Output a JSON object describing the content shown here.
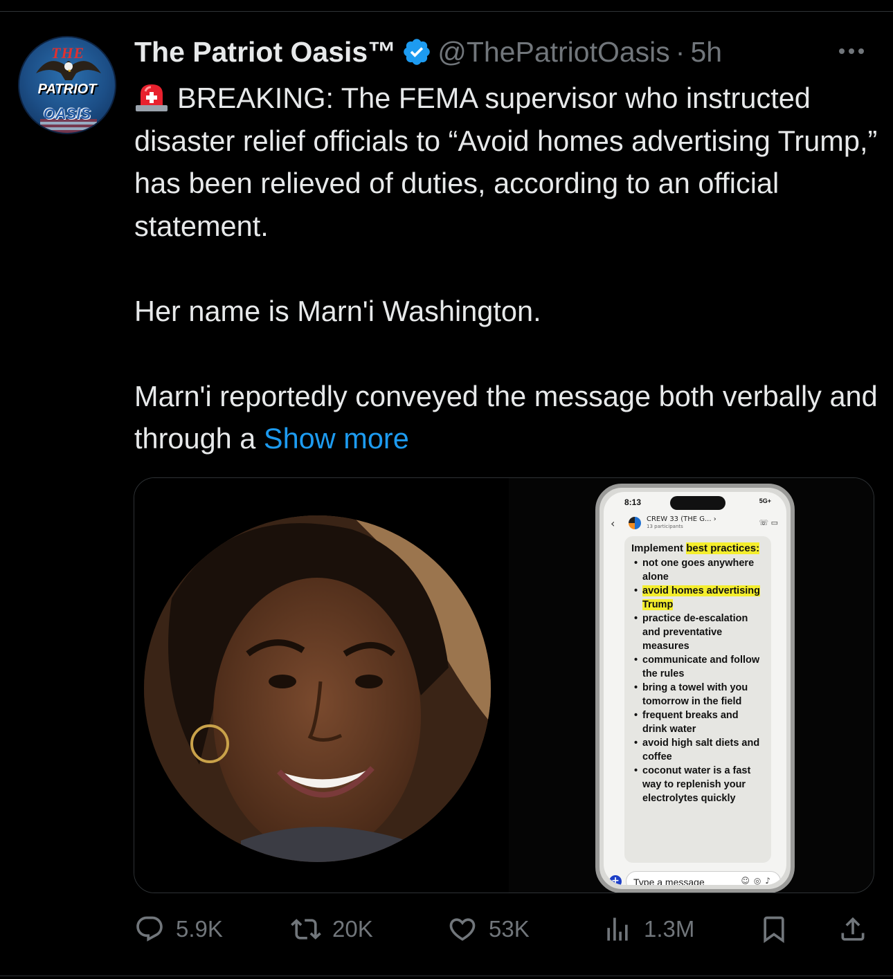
{
  "post": {
    "display_name": "The Patriot Oasis™",
    "handle": "@ThePatriotOasis",
    "separator": "·",
    "time": "5h",
    "avatar_text": {
      "line1": "THE",
      "line2": "PATRIOT",
      "line3": "OASIS"
    },
    "paragraph1": "BREAKING: The FEMA supervisor who instructed disaster relief officials to “Avoid homes advertising Trump,” has been relieved of duties, according to an official statement.",
    "paragraph2": "Her name is Marn'i Washington.",
    "paragraph3": "Marn'i reportedly conveyed the message both verbally and through a",
    "show_more": "Show more"
  },
  "phone": {
    "time": "8:13",
    "status": "5G+",
    "group_name": "CREW 33 (THE G... ›",
    "group_sub": "13 participants",
    "title_plain": "Implement",
    "title_hl": "best practices:",
    "items": [
      {
        "text": "not one goes anywhere alone",
        "highlight": false
      },
      {
        "text": "avoid homes advertising Trump",
        "highlight": true
      },
      {
        "text": "practice de-escalation and preventative measures",
        "highlight": false
      },
      {
        "text": "communicate and follow the rules",
        "highlight": false
      },
      {
        "text": "bring a towel with you tomorrow in the field",
        "highlight": false
      },
      {
        "text": "frequent breaks and drink water",
        "highlight": false
      },
      {
        "text": "avoid high salt diets and coffee",
        "highlight": false
      },
      {
        "text": "coconut water is a fast way to replenish your electrolytes quickly",
        "highlight": false
      }
    ],
    "input_placeholder": "Type a message"
  },
  "actions": {
    "replies": "5.9K",
    "reposts": "20K",
    "likes": "53K",
    "views": "1.3M"
  },
  "colors": {
    "background": "#000000",
    "text": "#e7e9ea",
    "muted": "#71767b",
    "link": "#1d9bf0",
    "verified": "#1d9bf0",
    "highlight": "#f4ee2d"
  }
}
